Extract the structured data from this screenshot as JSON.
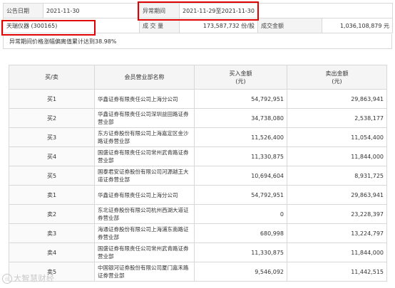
{
  "info": {
    "announce_label": "公告日期",
    "announce_date": "2021-11-30",
    "abnormal_label": "异常期间",
    "abnormal_period": "2021-11-29至2021-11-30",
    "stock": "天瑞仪器 (300165)",
    "volume_label": "成 交 量",
    "volume_value": "173,587,732 份/股",
    "amount_label": "成交金额",
    "amount_value": "1,036,108,879 元"
  },
  "note": "异常期间价格涨幅偏离值累计达到38.98%",
  "table": {
    "headers": {
      "side": "买/卖",
      "broker": "会员营业部名称",
      "buy": "买入金额\n(元)",
      "sell": "卖出金额\n(元)"
    },
    "rows": [
      {
        "side": "买1",
        "broker": "华鑫证券有限责任公司上海分公司",
        "buy": "54,792,951",
        "sell": "29,863,941"
      },
      {
        "side": "买2",
        "broker": "华鑫证券有限责任公司深圳益田路证券营业部",
        "buy": "34,738,080",
        "sell": "2,538,177"
      },
      {
        "side": "买3",
        "broker": "东方证券股份有限公司上海嘉定区金沙路证券营业部",
        "buy": "11,526,400",
        "sell": "11,054,400"
      },
      {
        "side": "买4",
        "broker": "国盛证券有限责任公司常州武青路证券营业部",
        "buy": "11,330,875",
        "sell": "11,844,000"
      },
      {
        "side": "买5",
        "broker": "国泰君安证券股份有限公司河源越王大道证券营业部",
        "buy": "10,694,604",
        "sell": "8,931,725"
      },
      {
        "side": "卖1",
        "broker": "华鑫证券有限责任公司上海分公司",
        "buy": "54,792,951",
        "sell": "29,863,941"
      },
      {
        "side": "卖2",
        "broker": "东北证券股份有限公司杭州西湖大道证券营业部",
        "buy": "0",
        "sell": "23,228,397"
      },
      {
        "side": "卖3",
        "broker": "海通证券股份有限公司上海浦东南路证券营业部",
        "buy": "680,998",
        "sell": "13,224,797"
      },
      {
        "side": "卖4",
        "broker": "国盛证券有限责任公司常州武青路证券营业部",
        "buy": "11,330,875",
        "sell": "11,844,000"
      },
      {
        "side": "卖5",
        "broker": "中国银河证券股份有限公司厦门嘉禾路证券营业部",
        "buy": "9,546,092",
        "sell": "11,442,515"
      }
    ]
  },
  "watermark": "大智慧财经",
  "highlight_color": "#e10000"
}
